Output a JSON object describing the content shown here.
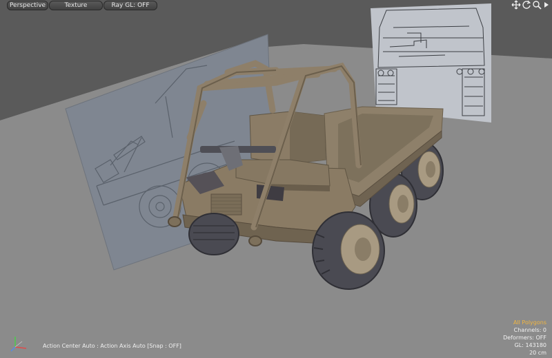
{
  "viewport": {
    "view_mode": "Perspective",
    "shading_mode": "Texture",
    "raygl": "Ray GL: OFF"
  },
  "nav_icons": [
    "move-view-icon",
    "rotate-view-icon",
    "zoom-view-icon",
    "maximize-viewport-icon"
  ],
  "status_bar": {
    "action_text": "Action Center Auto : Action Axis Auto  [Snap : OFF]"
  },
  "info_panel": {
    "selection": "All Polygons",
    "channels": "Channels: 0",
    "deformers": "Deformers: OFF",
    "gl_count": "GL: 143180",
    "grid_size": "20 cm"
  },
  "colors": {
    "background_upper": "#5c5c5c",
    "background_floor": "#8b8b8b",
    "vehicle_body": "#8a7a64",
    "tire": "#4a4a52",
    "selection_label": "#f2b640"
  }
}
